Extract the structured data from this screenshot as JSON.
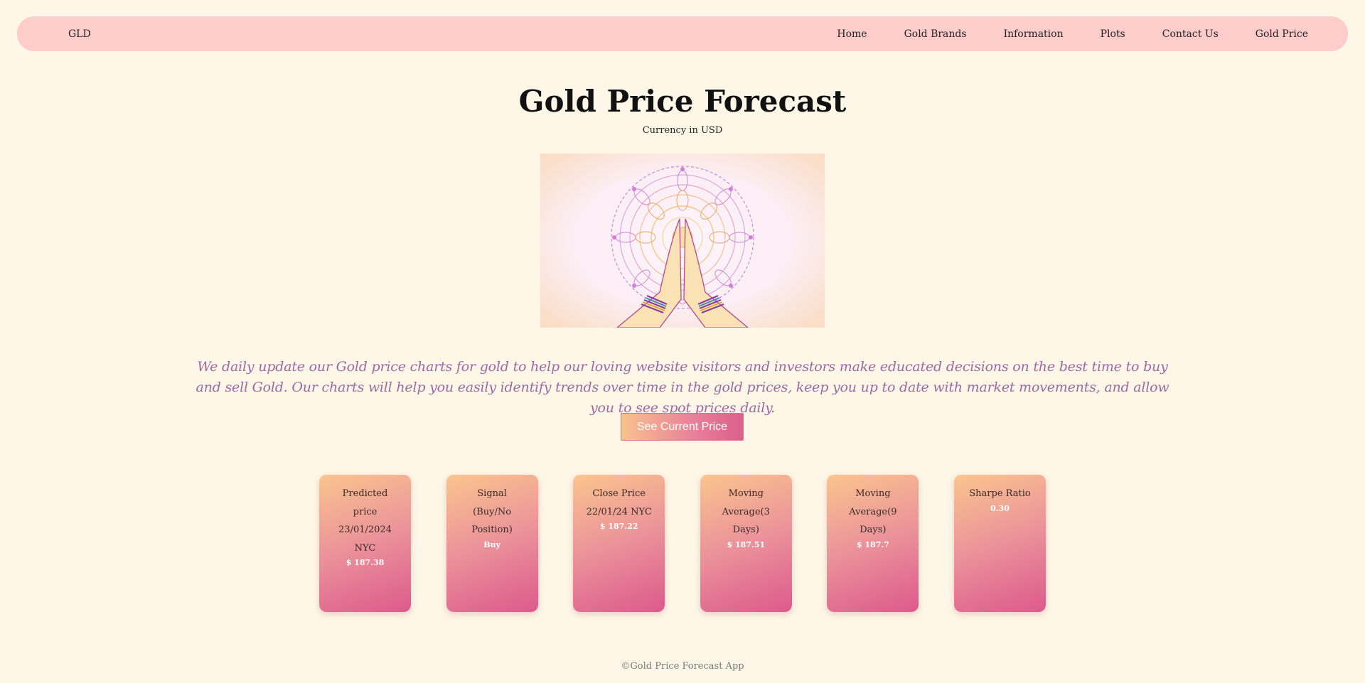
{
  "nav": {
    "brand": "GLD",
    "links": [
      "Home",
      "Gold Brands",
      "Information",
      "Plots",
      "Contact Us",
      "Gold Price"
    ]
  },
  "header": {
    "title": "Gold Price Forecast",
    "subtitle": "Currency in USD"
  },
  "blurb": "We daily update our Gold price charts for gold to help our loving website visitors and investors make educated decisions on the best time to buy and sell Gold. Our charts will help you easily identify trends over time in the gold prices, keep you up to date with market movements, and allow you to see spot prices daily.",
  "cta_label": "See Current Price",
  "cards": [
    {
      "label": "Predicted price 23/01/2024 NYC",
      "value": "$ 187.38"
    },
    {
      "label": "Signal (Buy/No Position)",
      "value": "Buy"
    },
    {
      "label": "Close Price 22/01/24 NYC",
      "value": "$ 187.22"
    },
    {
      "label": "Moving Average(3 Days)",
      "value": "$ 187.51"
    },
    {
      "label": "Moving Average(9 Days)",
      "value": "$ 187.7"
    },
    {
      "label": "Sharpe Ratio",
      "value": "0.30"
    }
  ],
  "footer": "©Gold Price Forecast App",
  "colors": {
    "background": "#fef6e6",
    "navbar": "#fecccb",
    "accent_start": "#fac58e",
    "accent_end": "#dd5a8c",
    "blurb": "#9a6aa3"
  }
}
